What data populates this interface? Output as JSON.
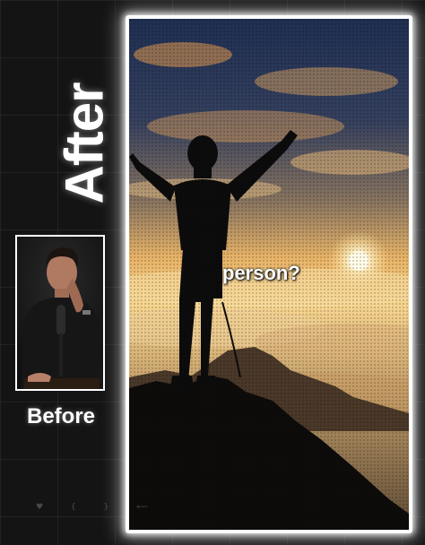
{
  "labels": {
    "after": "After",
    "before": "Before"
  },
  "caption": "person?",
  "icons": {
    "player_controls": "faint-player-control-icons"
  },
  "colors": {
    "background": "#141414",
    "frame_glow": "#ffffff",
    "sky_top": "#1f2f52",
    "sun": "#fff7d6",
    "silhouette": "#0c0c0c"
  }
}
